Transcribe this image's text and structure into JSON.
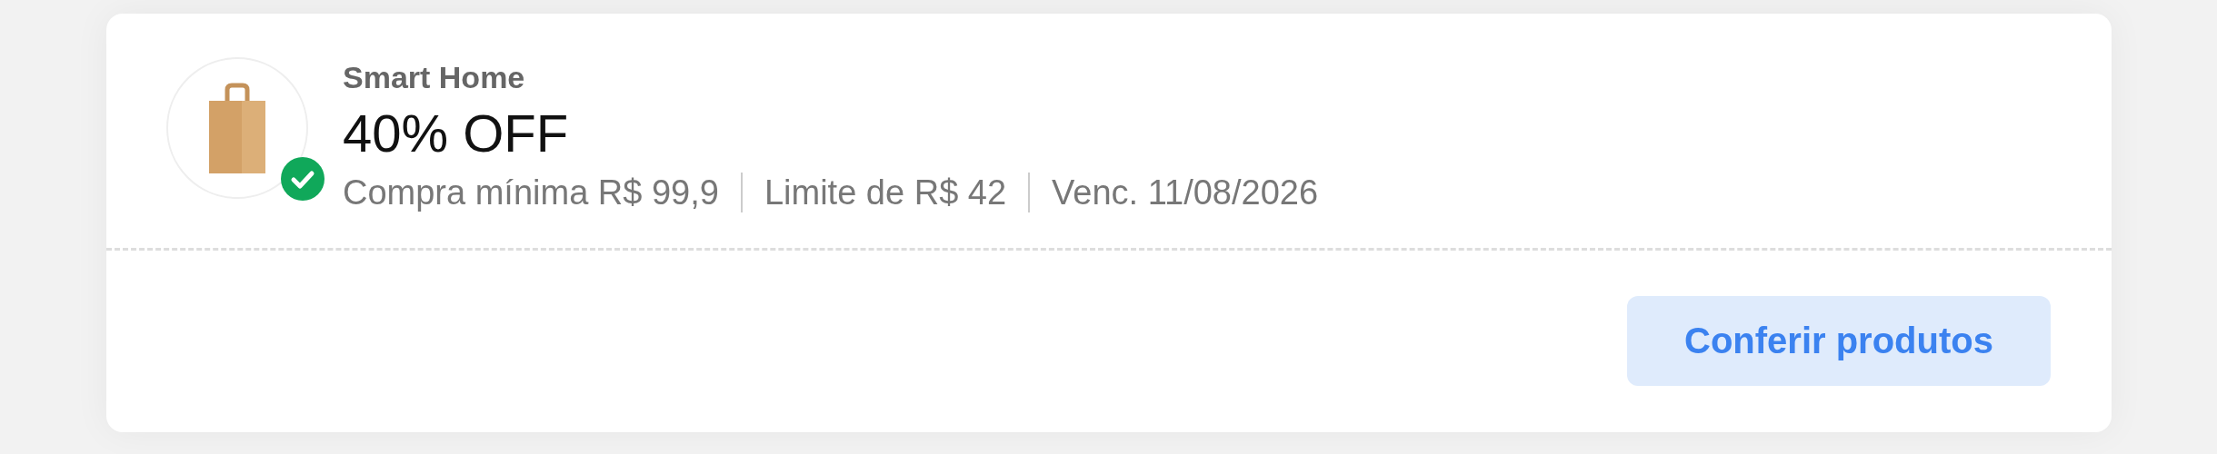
{
  "coupon": {
    "category": "Smart Home",
    "discount": "40% OFF",
    "conditions": [
      "Compra mínima R$ 99,9",
      "Limite de R$ 42",
      "Venc. 11/08/2026"
    ],
    "button": "Conferir produtos"
  }
}
